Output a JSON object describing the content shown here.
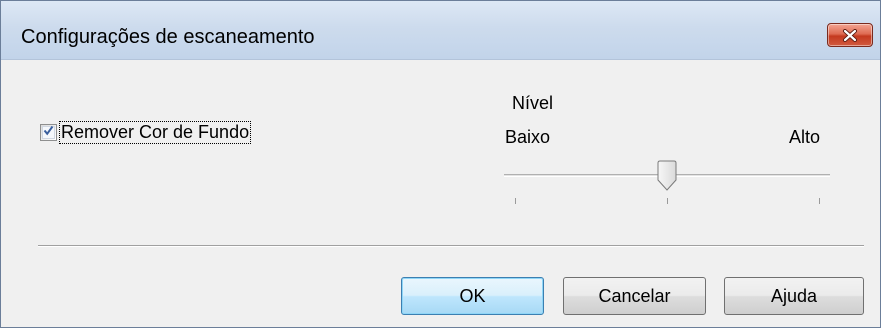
{
  "window": {
    "title": "Configurações de escaneamento"
  },
  "options": {
    "remove_background_label": "Remover Cor de Fundo",
    "remove_background_checked": true
  },
  "level": {
    "label": "Nível",
    "low_label": "Baixo",
    "high_label": "Alto",
    "slider_fraction": 0.5,
    "tick_count": 3
  },
  "buttons": {
    "ok": "OK",
    "cancel": "Cancelar",
    "help": "Ajuda"
  },
  "icons": {
    "close": "close-x-icon",
    "check": "checkmark-icon"
  },
  "colors": {
    "close_button": "#c4391f",
    "default_button_border": "#3c7fb1",
    "check_mark": "#3a5f9e"
  }
}
